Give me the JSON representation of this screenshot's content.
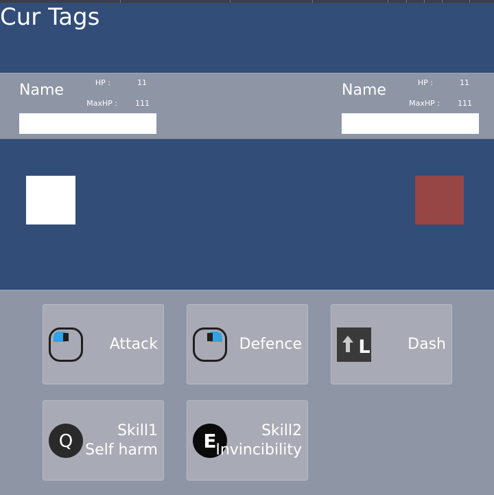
{
  "header": {
    "title": "Cur Tags"
  },
  "player": {
    "name": "Name",
    "hp_label": "HP :",
    "hp_value": "11",
    "maxhp_label": "MaxHP :",
    "maxhp_value": "111",
    "hp_fill_fraction": 1.0,
    "sprite_color": "#ffffff"
  },
  "enemy": {
    "name": "Name",
    "hp_label": "HP :",
    "hp_value": "11",
    "maxhp_label": "MaxHP :",
    "maxhp_value": "111",
    "hp_fill_fraction": 1.0,
    "sprite_color": "#974545"
  },
  "controls": {
    "attack": {
      "label": "Attack",
      "icon": "mouse-left-click-icon"
    },
    "defence": {
      "label": "Defence",
      "icon": "mouse-right-click-icon"
    },
    "dash": {
      "label": "Dash",
      "icon": "shift-l-key-icon",
      "key_letter": "L"
    },
    "skill1": {
      "label_line1": "Skill1",
      "label_line2": "Self harm",
      "icon": "q-key-icon",
      "key_letter": "Q"
    },
    "skill2": {
      "label_line1": "Skill2",
      "label_line2": "Invincibility",
      "icon": "e-key-icon",
      "key_letter": "E"
    }
  },
  "colors": {
    "background": "#314d78",
    "panel": "#8e95a5",
    "button": "#a8abb5",
    "accent_blue": "#2ea3e6"
  }
}
